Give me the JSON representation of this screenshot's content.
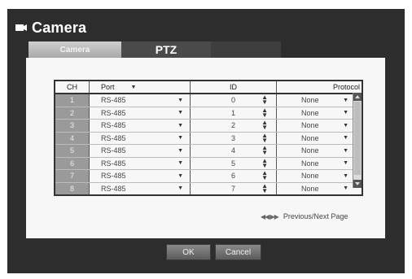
{
  "window": {
    "title": "Camera",
    "icon": "camera-icon"
  },
  "tabs": [
    {
      "label": "Camera",
      "active": false
    },
    {
      "label": "PTZ",
      "active": true
    }
  ],
  "table": {
    "headers": {
      "ch": "CH",
      "port": "Port",
      "id": "ID",
      "protocol": "Protocol"
    },
    "rows": [
      {
        "ch": "1",
        "port": "RS-485",
        "id": "0",
        "protocol": "None"
      },
      {
        "ch": "2",
        "port": "RS-485",
        "id": "1",
        "protocol": "None"
      },
      {
        "ch": "3",
        "port": "RS-485",
        "id": "2",
        "protocol": "None"
      },
      {
        "ch": "4",
        "port": "RS-485",
        "id": "3",
        "protocol": "None"
      },
      {
        "ch": "5",
        "port": "RS-485",
        "id": "4",
        "protocol": "None"
      },
      {
        "ch": "6",
        "port": "RS-485",
        "id": "5",
        "protocol": "None"
      },
      {
        "ch": "7",
        "port": "RS-485",
        "id": "6",
        "protocol": "None"
      },
      {
        "ch": "8",
        "port": "RS-485",
        "id": "7",
        "protocol": "None"
      }
    ]
  },
  "pager": {
    "icon": "prev-next-page-icon",
    "label": "Previous/Next Page"
  },
  "buttons": {
    "ok": "OK",
    "cancel": "Cancel"
  },
  "colors": {
    "dialog_bg": "#2d2d2d",
    "panel_bg": "#f7f7f7",
    "ch_cell_bg": "#9a9a9a"
  }
}
